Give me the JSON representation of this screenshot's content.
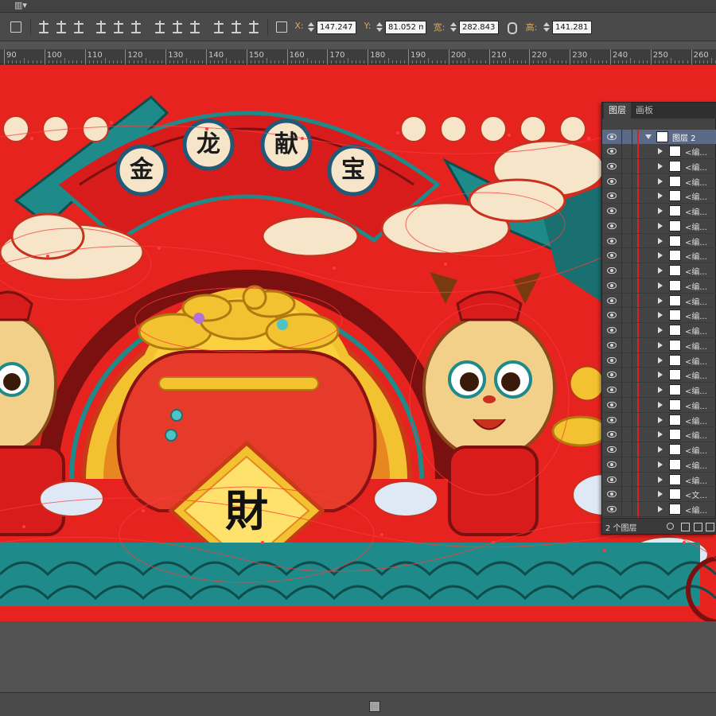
{
  "control_bar": {
    "x_label": "X:",
    "x_value": "147.247",
    "y_label": "Y:",
    "y_value": "81.052 m",
    "w_label": "宽:",
    "w_value": "282.843",
    "h_label": "高:",
    "h_value": "141.281"
  },
  "ruler": {
    "ticks": [
      "90",
      "100",
      "110",
      "120",
      "130",
      "140",
      "150",
      "160",
      "170",
      "180",
      "190",
      "200",
      "210",
      "220",
      "230",
      "240",
      "250",
      "260"
    ]
  },
  "artwork": {
    "title_chars": [
      "金",
      "龙",
      "献",
      "宝"
    ],
    "center_char": "財",
    "colors": {
      "background": "#e6231f",
      "gold": "#f2c230",
      "teal": "#1f8a8a",
      "cream": "#f6e5c8",
      "dark": "#1b1b1b"
    }
  },
  "layers_panel": {
    "tabs": [
      "图层",
      "画板"
    ],
    "parent_layer": "图层 2",
    "rows": [
      {
        "name": "<编..."
      },
      {
        "name": "<编..."
      },
      {
        "name": "<编..."
      },
      {
        "name": "<编..."
      },
      {
        "name": "<编..."
      },
      {
        "name": "<编..."
      },
      {
        "name": "<编..."
      },
      {
        "name": "<编..."
      },
      {
        "name": "<编..."
      },
      {
        "name": "<编..."
      },
      {
        "name": "<编..."
      },
      {
        "name": "<编..."
      },
      {
        "name": "<编..."
      },
      {
        "name": "<编..."
      },
      {
        "name": "<编..."
      },
      {
        "name": "<编..."
      },
      {
        "name": "<编..."
      },
      {
        "name": "<编..."
      },
      {
        "name": "<编..."
      },
      {
        "name": "<编..."
      },
      {
        "name": "<编..."
      },
      {
        "name": "<编..."
      },
      {
        "name": "<编..."
      },
      {
        "name": "<文..."
      },
      {
        "name": "<编..."
      },
      {
        "name": "<编..."
      }
    ],
    "footer_count": "2 个图层"
  }
}
